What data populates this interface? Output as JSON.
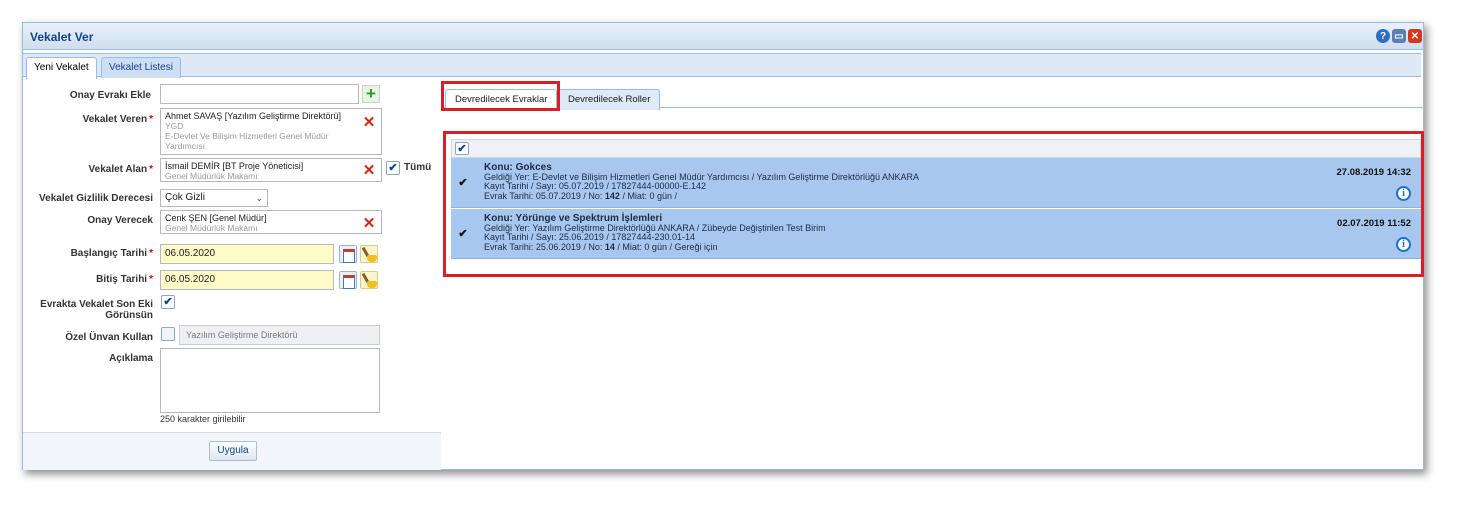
{
  "window": {
    "title": "Vekalet Ver",
    "controls": {
      "help": "?",
      "screen": "▭",
      "close": "✕"
    }
  },
  "main_tabs": [
    {
      "label": "Yeni Vekalet",
      "active": true
    },
    {
      "label": "Vekalet Listesi",
      "active": false
    }
  ],
  "form": {
    "onay_evraki_label": "Onay Evrakı Ekle",
    "vekalet_veren": {
      "label": "Vekalet Veren",
      "required": "*",
      "name": "Ahmet SAVAŞ [Yazılım Geliştirme Direktörü]",
      "line2": "YGD",
      "line3": "E-Devlet Ve Bilişim Hizmetleri Genel Müdür",
      "line4": "Yardımcısı"
    },
    "vekalet_alan": {
      "label": "Vekalet Alan",
      "required": "*",
      "name": "İsmail DEMİR [BT Proje Yöneticisi]",
      "unit": "Genel Müdürlük Makamı",
      "all_label": "Tümü"
    },
    "gizlilik": {
      "label": "Vekalet Gizlilik Derecesi",
      "value": "Çok Gizli"
    },
    "onay_verecek": {
      "label": "Onay Verecek",
      "name": "Cenk ŞEN [Genel Müdür]",
      "unit": "Genel Müdürlük Makamı"
    },
    "baslangic": {
      "label": "Başlangıç Tarihi",
      "required": "*",
      "value": "06.05.2020"
    },
    "bitis": {
      "label": "Bitiş Tarihi",
      "required": "*",
      "value": "06.05.2020"
    },
    "son_ek": {
      "label_line1": "Evrakta Vekalet Son Eki",
      "label_line2": "Görünsün",
      "checked": true
    },
    "ozel_unvan": {
      "label": "Özel Ünvan Kullan",
      "placeholder": "Yazılım Geliştirme Direktörü",
      "checked": false
    },
    "aciklama": {
      "label": "Açıklama",
      "hint": "250 karakter girilebilir"
    },
    "apply_label": "Uygula"
  },
  "sub_tabs": [
    {
      "label": "Devredilecek Evraklar",
      "active": true
    },
    {
      "label": "Devredilecek Roller",
      "active": false
    }
  ],
  "documents": [
    {
      "subject": "Konu: Gokces",
      "origin": "Geldiği Yer: E-Devlet ve Bilişim Hizmetleri Genel Müdür Yardımcısı / Yazılım Geliştirme Direktörlüğü ANKARA",
      "record": "Kayıt Tarihi / Sayı: 05.07.2019 / 17827444-00000-E.142",
      "doc_prefix": "Evrak Tarihi: 05.07.2019 / No: ",
      "doc_no": "142",
      "doc_suffix": " / Miat: 0 gün /",
      "date": "27.08.2019 14:32",
      "checked": true
    },
    {
      "subject": "Konu: Yörünge ve Spektrum İşlemleri",
      "origin": "Geldiği Yer: Yazılım Geliştirme Direktörlüğü ANKARA / Zübeyde Değiştirilen Test Birim",
      "record": "Kayıt Tarihi / Sayı: 25.06.2019 / 17827444-230.01-14",
      "doc_prefix": "Evrak Tarihi: 25.06.2019 / No: ",
      "doc_no": "14",
      "doc_suffix": " / Miat: 0 gün / Gereği için",
      "date": "02.07.2019 11:52",
      "checked": true
    }
  ],
  "icons": {
    "check": "✔",
    "remove": "✕",
    "add": "+",
    "info": "i",
    "dropdown": "⌄"
  }
}
